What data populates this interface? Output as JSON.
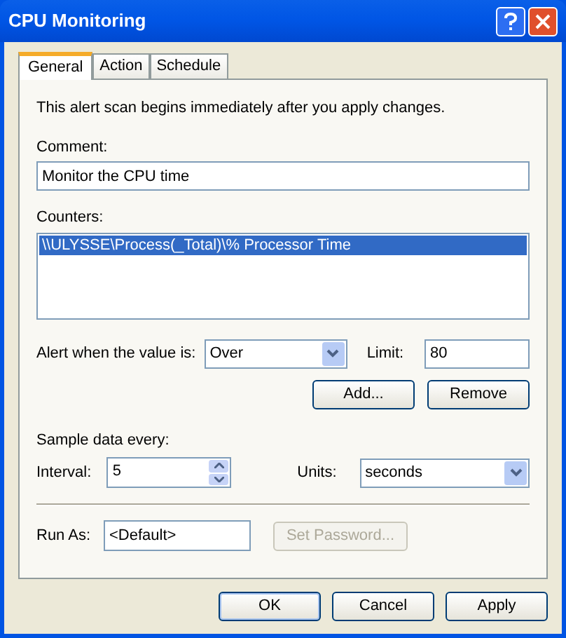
{
  "window": {
    "title": "CPU Monitoring"
  },
  "tabs": [
    {
      "label": "General",
      "selected": true
    },
    {
      "label": "Action",
      "selected": false
    },
    {
      "label": "Schedule",
      "selected": false
    }
  ],
  "intro": "This alert scan begins immediately after you apply changes.",
  "comment": {
    "label": "Comment:",
    "value": "Monitor the CPU time"
  },
  "counters": {
    "label": "Counters:",
    "items": [
      {
        "text": "\\\\ULYSSE\\Process(_Total)\\% Processor Time",
        "selected": true
      }
    ]
  },
  "alert": {
    "label": "Alert when the value is:",
    "value": "Over",
    "limit_label": "Limit:",
    "limit": "80"
  },
  "counter_buttons": [
    {
      "label": "Add...",
      "disabled": false
    },
    {
      "label": "Remove",
      "disabled": false
    }
  ],
  "sample": {
    "label": "Sample data every:",
    "interval_label": "Interval:",
    "interval": "5",
    "units_label": "Units:",
    "units": "seconds"
  },
  "run_as": {
    "label": "Run As:",
    "value": "<Default>",
    "button": {
      "label": "Set Password...",
      "disabled": true
    }
  },
  "buttons": [
    {
      "label": "OK",
      "default": true
    },
    {
      "label": "Cancel",
      "default": false
    },
    {
      "label": "Apply",
      "default": false
    }
  ]
}
